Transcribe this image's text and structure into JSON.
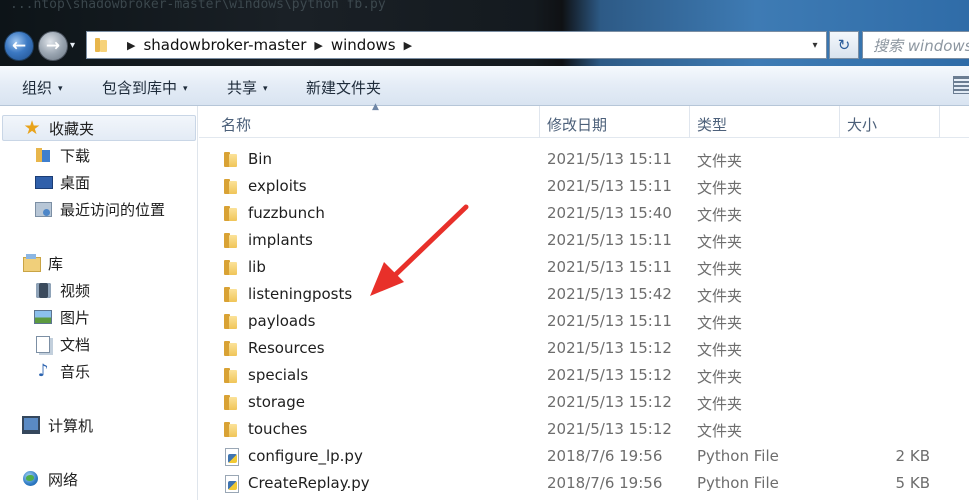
{
  "window": {
    "ghost_title": "...ntop\\shadowbroker-master\\windows\\python fb.py"
  },
  "nav": {
    "back_glyph": "←",
    "forward_glyph": "→",
    "dropdown_glyph": "▾"
  },
  "address": {
    "crumbs": [
      "shadowbroker-master",
      "windows"
    ],
    "sep_glyph": "▶",
    "dropdown_glyph": "▾",
    "refresh_glyph": "↻"
  },
  "search": {
    "placeholder": "搜索 windows"
  },
  "toolbar": {
    "organize": "组织",
    "include_in_library": "包含到库中",
    "share": "共享",
    "new_folder": "新建文件夹",
    "caret": "▾"
  },
  "navpane": {
    "favorites": "收藏夹",
    "downloads": "下载",
    "desktop": "桌面",
    "recent": "最近访问的位置",
    "libraries": "库",
    "videos": "视频",
    "pictures": "图片",
    "documents": "文档",
    "music": "音乐",
    "computer": "计算机",
    "network": "网络"
  },
  "columns": {
    "name": "名称",
    "modified": "修改日期",
    "type": "类型",
    "size": "大小",
    "sort_glyph": "▲"
  },
  "files": [
    {
      "name": "Bin",
      "date": "2021/5/13 15:11",
      "type": "文件夹",
      "size": "",
      "icon": "folder-icon"
    },
    {
      "name": "exploits",
      "date": "2021/5/13 15:11",
      "type": "文件夹",
      "size": "",
      "icon": "folder-icon"
    },
    {
      "name": "fuzzbunch",
      "date": "2021/5/13 15:40",
      "type": "文件夹",
      "size": "",
      "icon": "folder-icon"
    },
    {
      "name": "implants",
      "date": "2021/5/13 15:11",
      "type": "文件夹",
      "size": "",
      "icon": "folder-icon"
    },
    {
      "name": "lib",
      "date": "2021/5/13 15:11",
      "type": "文件夹",
      "size": "",
      "icon": "folder-icon"
    },
    {
      "name": "listeningposts",
      "date": "2021/5/13 15:42",
      "type": "文件夹",
      "size": "",
      "icon": "folder-icon"
    },
    {
      "name": "payloads",
      "date": "2021/5/13 15:11",
      "type": "文件夹",
      "size": "",
      "icon": "folder-icon"
    },
    {
      "name": "Resources",
      "date": "2021/5/13 15:12",
      "type": "文件夹",
      "size": "",
      "icon": "folder-icon"
    },
    {
      "name": "specials",
      "date": "2021/5/13 15:12",
      "type": "文件夹",
      "size": "",
      "icon": "folder-icon"
    },
    {
      "name": "storage",
      "date": "2021/5/13 15:12",
      "type": "文件夹",
      "size": "",
      "icon": "folder-icon"
    },
    {
      "name": "touches",
      "date": "2021/5/13 15:12",
      "type": "文件夹",
      "size": "",
      "icon": "folder-icon"
    },
    {
      "name": "configure_lp.py",
      "date": "2018/7/6 19:56",
      "type": "Python File",
      "size": "2 KB",
      "icon": "python-file-icon"
    },
    {
      "name": "CreateReplay.py",
      "date": "2018/7/6 19:56",
      "type": "Python File",
      "size": "5 KB",
      "icon": "python-file-icon"
    }
  ],
  "annotation": {
    "color": "#e8302a"
  }
}
